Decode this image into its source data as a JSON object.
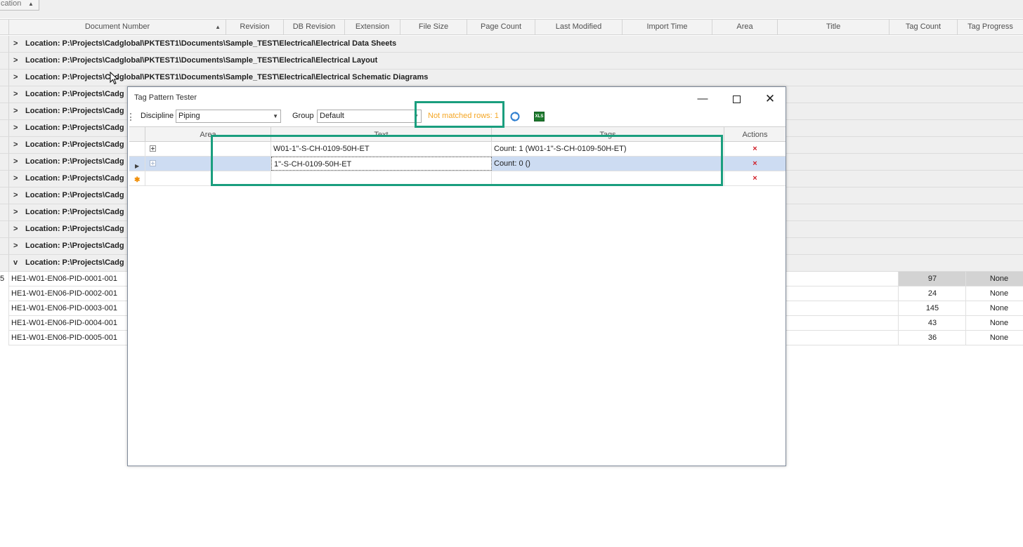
{
  "group_panel": {
    "chip_label": "cation"
  },
  "columns": {
    "document_number": "Document Number",
    "revision": "Revision",
    "db_revision": "DB Revision",
    "extension": "Extension",
    "file_size": "File Size",
    "page_count": "Page Count",
    "last_modified": "Last Modified",
    "import_time": "Import Time",
    "area": "Area",
    "title": "Title",
    "tag_count": "Tag Count",
    "tag_progress": "Tag Progress"
  },
  "group_rows": [
    "Location: P:\\Projects\\Cadglobal\\PKTEST1\\Documents\\Sample_TEST\\Electrical\\Electrical Data Sheets",
    "Location: P:\\Projects\\Cadglobal\\PKTEST1\\Documents\\Sample_TEST\\Electrical\\Electrical Layout",
    "Location: P:\\Projects\\Cadglobal\\PKTEST1\\Documents\\Sample_TEST\\Electrical\\Electrical Schematic Diagrams",
    "Location: P:\\Projects\\Cadg",
    "Location: P:\\Projects\\Cadg",
    "Location: P:\\Projects\\Cadg",
    "Location: P:\\Projects\\Cadg",
    "Location: P:\\Projects\\Cadg",
    "Location: P:\\Projects\\Cadg",
    "Location: P:\\Projects\\Cadg",
    "Location: P:\\Projects\\Cadg",
    "Location: P:\\Projects\\Cadg",
    "Location: P:\\Projects\\Cadg",
    "Location: P:\\Projects\\Cadg"
  ],
  "group_chevrons": [
    ">",
    ">",
    ">",
    ">",
    ">",
    ">",
    ">",
    ">",
    ">",
    ">",
    ">",
    ">",
    ">",
    "v"
  ],
  "data_rows": [
    {
      "doc": "HE1-W01-EN06-PID-0001-001",
      "tag_count": "97",
      "tag_progress": "None",
      "prefix": "5"
    },
    {
      "doc": "HE1-W01-EN06-PID-0002-001",
      "tag_count": "24",
      "tag_progress": "None"
    },
    {
      "doc": "HE1-W01-EN06-PID-0003-001",
      "tag_count": "145",
      "tag_progress": "None"
    },
    {
      "doc": "HE1-W01-EN06-PID-0004-001",
      "tag_count": "43",
      "tag_progress": "None"
    },
    {
      "doc": "HE1-W01-EN06-PID-0005-001",
      "tag_count": "36",
      "tag_progress": "None"
    }
  ],
  "dialog": {
    "title": "Tag Pattern Tester",
    "discipline_label": "Discipline",
    "discipline_value": "Piping",
    "group_label": "Group",
    "group_value": "Default",
    "not_matched": "Not matched rows: 1",
    "excel_icon_text": "XLS",
    "grid_columns": {
      "area": "Area",
      "text": "Text",
      "tags": "Tags",
      "actions": "Actions"
    },
    "rows": [
      {
        "text": "W01-1\"-S-CH-0109-50H-ET",
        "tags": "Count: 1 (W01-1\"-S-CH-0109-50H-ET)",
        "action": "×"
      },
      {
        "text": "1\"-S-CH-0109-50H-ET",
        "tags": "Count: 0 ()",
        "action": "×"
      },
      {
        "text": "",
        "tags": "",
        "action": "×"
      }
    ]
  },
  "colors": {
    "annotation": "#1a9e7e",
    "warning_text": "#f5a623",
    "selected_row": "#cddcf2",
    "delete": "#d0202a"
  }
}
